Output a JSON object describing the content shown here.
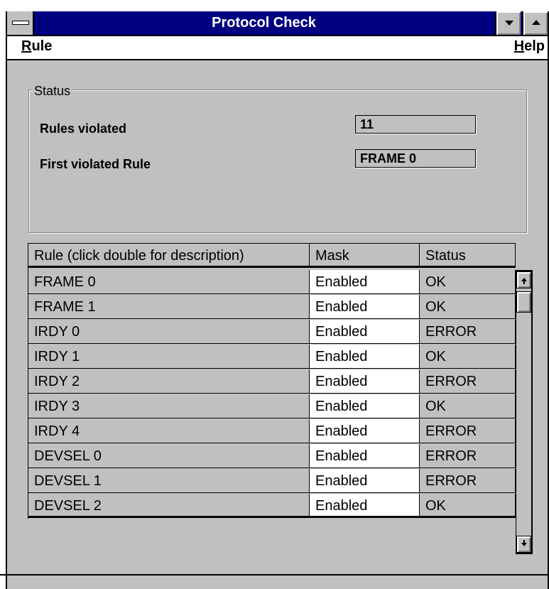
{
  "window": {
    "title": "Protocol Check",
    "icons": {
      "system_menu": "system-menu-icon",
      "minimize": "minimize-arrow-icon",
      "maximize": "maximize-arrow-icon"
    }
  },
  "menubar": {
    "rule": {
      "accel": "R",
      "rest": "ule"
    },
    "help": {
      "accel": "H",
      "rest": "elp"
    }
  },
  "status": {
    "group_label": "Status",
    "rules_violated_label": "Rules violated",
    "rules_violated_value": "11",
    "first_violated_label": "First violated Rule",
    "first_violated_value": "FRAME 0"
  },
  "table": {
    "columns": [
      "Rule (click double for description)",
      "Mask",
      "Status"
    ],
    "rows": [
      {
        "rule": "FRAME 0",
        "mask": "Enabled",
        "status": "OK"
      },
      {
        "rule": "FRAME 1",
        "mask": "Enabled",
        "status": "OK"
      },
      {
        "rule": "IRDY 0",
        "mask": "Enabled",
        "status": "ERROR"
      },
      {
        "rule": "IRDY 1",
        "mask": "Enabled",
        "status": "OK"
      },
      {
        "rule": "IRDY 2",
        "mask": "Enabled",
        "status": "ERROR"
      },
      {
        "rule": "IRDY 3",
        "mask": "Enabled",
        "status": "OK"
      },
      {
        "rule": "IRDY 4",
        "mask": "Enabled",
        "status": "ERROR"
      },
      {
        "rule": "DEVSEL 0",
        "mask": "Enabled",
        "status": "ERROR"
      },
      {
        "rule": "DEVSEL 1",
        "mask": "Enabled",
        "status": "ERROR"
      },
      {
        "rule": "DEVSEL 2",
        "mask": "Enabled",
        "status": "OK"
      }
    ]
  },
  "scrollbar": {
    "up_icon": "scroll-up-arrow-icon",
    "down_icon": "scroll-down-arrow-icon"
  }
}
